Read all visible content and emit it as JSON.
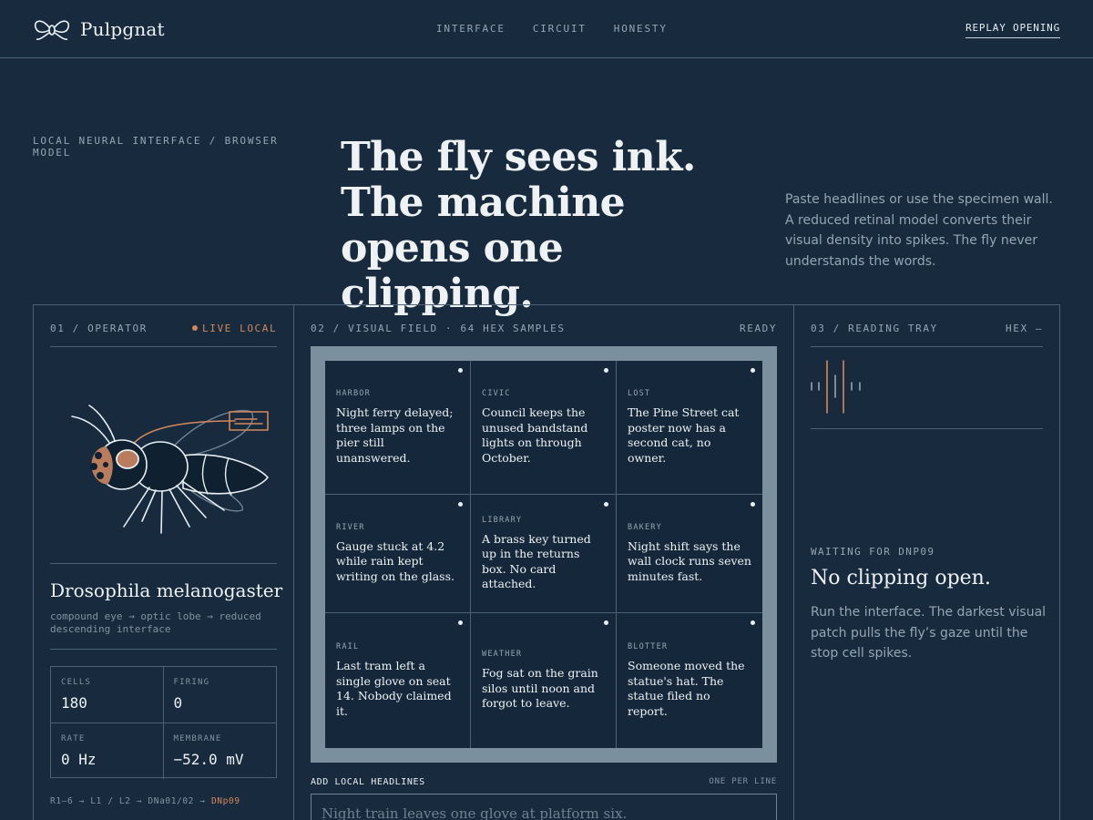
{
  "header": {
    "brand": "Pulpgnat",
    "logo_icon": "fly-wings-icon",
    "nav": [
      "INTERFACE",
      "CIRCUIT",
      "HONESTY"
    ],
    "replay_label": "REPLAY OPENING"
  },
  "hero": {
    "kicker": "LOCAL NEURAL INTERFACE / BROWSER MODEL",
    "headline": "The fly sees ink. The machine opens one clipping.",
    "intro": "Paste headlines or use the specimen wall. A reduced retinal model converts their visual density into spikes. The fly never understands the words."
  },
  "operator": {
    "label": "01 / OPERATOR",
    "status": "LIVE LOCAL",
    "illustration_icon": "drosophila-icon",
    "species": "Drosophila melanogaster",
    "pathway": "compound eye → optic lobe → reduced descending interface",
    "stats": [
      {
        "label": "CELLS",
        "value": "180"
      },
      {
        "label": "FIRING",
        "value": "0"
      },
      {
        "label": "RATE",
        "value": "0 Hz"
      },
      {
        "label": "MEMBRANE",
        "value": "−52.0 mV"
      }
    ],
    "circuit_prefix": "R1–6 → L1 / L2 → DNa01/02 → ",
    "circuit_end": "DNp09"
  },
  "visual_field": {
    "label": "02 / VISUAL FIELD · 64 HEX SAMPLES",
    "status": "READY",
    "cells": [
      {
        "tag": "HARBOR",
        "text": "Night ferry delayed; three lamps on the pier still unanswered."
      },
      {
        "tag": "CIVIC",
        "text": "Council keeps the unused bandstand lights on through October."
      },
      {
        "tag": "LOST",
        "text": "The Pine Street cat poster now has a second cat, no owner."
      },
      {
        "tag": "RIVER",
        "text": "Gauge stuck at 4.2 while rain kept writing on the glass."
      },
      {
        "tag": "LIBRARY",
        "text": "A brass key turned up in the returns box. No card attached."
      },
      {
        "tag": "BAKERY",
        "text": "Night shift says the wall clock runs seven minutes fast."
      },
      {
        "tag": "RAIL",
        "text": "Last tram left a single glove on seat 14. Nobody claimed it."
      },
      {
        "tag": "WEATHER",
        "text": "Fog sat on the grain silos until noon and forgot to leave."
      },
      {
        "tag": "BLOTTER",
        "text": "Someone moved the statue's hat. The statue filed no report."
      }
    ],
    "add_label": "ADD LOCAL HEADLINES",
    "per_line": "ONE PER LINE",
    "input_placeholder": "Night train leaves one glove at platform six."
  },
  "reading_tray": {
    "label": "03 / READING TRAY",
    "hex": "HEX —",
    "spike_icon": "spike-raster-icon",
    "waiting": "WAITING FOR DNP09",
    "title": "No clipping open.",
    "description": "Run the interface. The darkest visual patch pulls the fly’s gaze until the stop cell spikes."
  },
  "colors": {
    "background": "#182b3e",
    "accent": "#d4875a",
    "border": "#4a6275",
    "muted_text": "#93a6b5",
    "field_frame": "#7b909e"
  }
}
